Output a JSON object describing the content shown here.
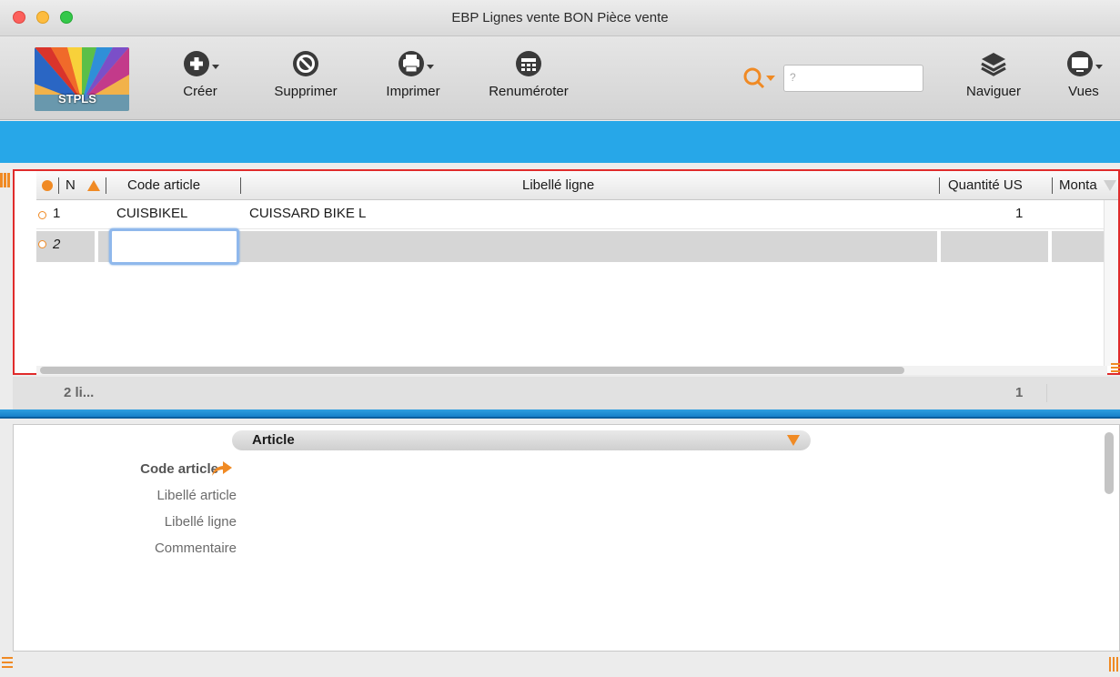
{
  "window": {
    "title": "EBP Lignes vente BON Pièce vente"
  },
  "logo": {
    "text": "STPLS"
  },
  "toolbar": {
    "create_label": "Créer",
    "delete_label": "Supprimer",
    "print_label": "Imprimer",
    "renumber_label": "Renuméroter",
    "navigate_label": "Naviguer",
    "views_label": "Vues"
  },
  "search": {
    "placeholder": "?",
    "value": ""
  },
  "grid": {
    "columns": {
      "n": "N",
      "code": "Code article",
      "libelle": "Libellé ligne",
      "qty": "Quantité US",
      "montant": "Monta"
    },
    "rows": [
      {
        "n": "1",
        "code": "CUISBIKEL",
        "libelle": "CUISSARD BIKE L",
        "qty": "1"
      },
      {
        "n": "2",
        "code": "",
        "libelle": "",
        "qty": ""
      }
    ],
    "footer": {
      "count": "2 li...",
      "qty_total": "1"
    }
  },
  "detail": {
    "section_title": "Article",
    "fields": {
      "code_article": "Code article",
      "libelle_article": "Libellé article",
      "libelle_ligne": "Libellé ligne",
      "commentaire": "Commentaire"
    }
  },
  "colors": {
    "accent": "#f08a24",
    "blue": "#27a7e8",
    "selection_border": "#e02b2b"
  }
}
